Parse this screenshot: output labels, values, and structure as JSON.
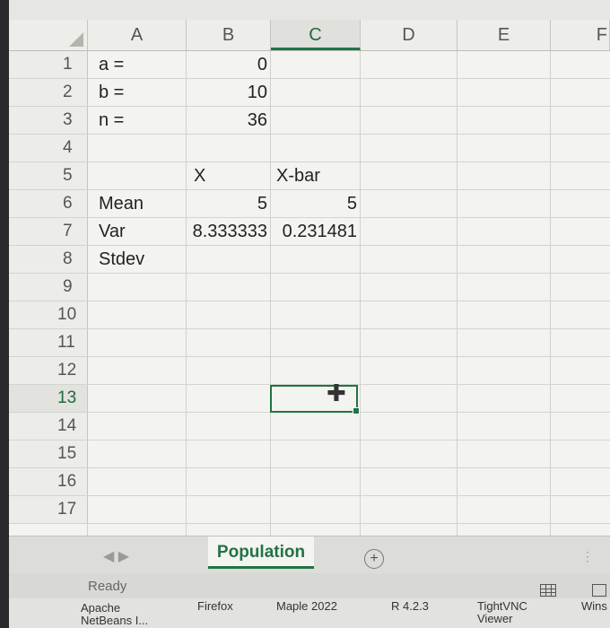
{
  "columns": [
    "A",
    "B",
    "C",
    "D",
    "E",
    "F"
  ],
  "rows": [
    {
      "n": "1",
      "a": "a =",
      "b": "0",
      "c": ""
    },
    {
      "n": "2",
      "a": "b =",
      "b": "10",
      "c": ""
    },
    {
      "n": "3",
      "a": "n =",
      "b": "36",
      "c": ""
    },
    {
      "n": "4",
      "a": "",
      "b": "",
      "c": ""
    },
    {
      "n": "5",
      "a": "",
      "b": "X",
      "c": "X-bar"
    },
    {
      "n": "6",
      "a": "Mean",
      "b": "5",
      "c": "5"
    },
    {
      "n": "7",
      "a": "Var",
      "b": "8.333333",
      "c": "0.231481"
    },
    {
      "n": "8",
      "a": "Stdev",
      "b": "",
      "c": ""
    },
    {
      "n": "9",
      "a": "",
      "b": "",
      "c": ""
    },
    {
      "n": "10",
      "a": "",
      "b": "",
      "c": ""
    },
    {
      "n": "11",
      "a": "",
      "b": "",
      "c": ""
    },
    {
      "n": "12",
      "a": "",
      "b": "",
      "c": ""
    },
    {
      "n": "13",
      "a": "",
      "b": "",
      "c": ""
    },
    {
      "n": "14",
      "a": "",
      "b": "",
      "c": ""
    },
    {
      "n": "15",
      "a": "",
      "b": "",
      "c": ""
    },
    {
      "n": "16",
      "a": "",
      "b": "",
      "c": ""
    },
    {
      "n": "17",
      "a": "",
      "b": "",
      "c": ""
    }
  ],
  "sheet_tab": "Population",
  "add_sheet": "+",
  "status": "Ready",
  "taskbar": [
    {
      "label": "Apache NetBeans I..."
    },
    {
      "label": "Firefox"
    },
    {
      "label": "Maple 2022"
    },
    {
      "label": "R 4.2.3"
    },
    {
      "label": "TightVNC Viewer"
    },
    {
      "label": "Wins"
    }
  ],
  "accent_color": "#217346"
}
